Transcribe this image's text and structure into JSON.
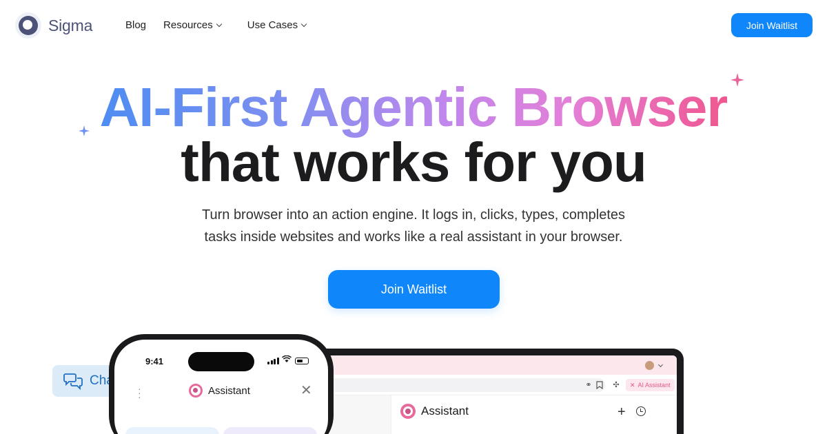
{
  "nav": {
    "brand": "Sigma",
    "links": [
      {
        "label": "Blog"
      },
      {
        "label": "Resources"
      },
      {
        "label": "Use Cases"
      }
    ],
    "cta": "Join Waitlist"
  },
  "hero": {
    "headline_gradient": "AI-First Agentic Browser",
    "headline_dark": "that works for you",
    "sub_line1": "Turn browser into an action engine. It logs in, clicks, types, completes",
    "sub_line2": "tasks inside websites and works like a real assistant in your browser.",
    "cta": "Join Waitlist"
  },
  "chat_pill": {
    "label": "Cha"
  },
  "phone": {
    "time": "9:41",
    "title": "Assistant"
  },
  "laptop": {
    "ai_badge": "AI Assistant",
    "title": "Assistant"
  },
  "colors": {
    "accent": "#0f86f9",
    "brand": "#4c5278",
    "gradient_start": "#4e8df2",
    "gradient_end": "#f0568f",
    "assistant_pink": "#e86a9c"
  }
}
